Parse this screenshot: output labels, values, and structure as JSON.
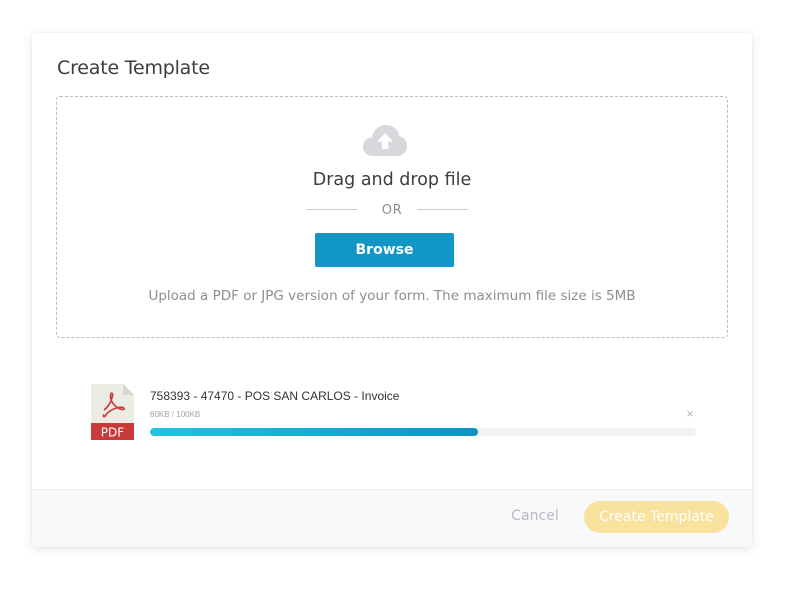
{
  "modal": {
    "title": "Create Template"
  },
  "dropzone": {
    "icon": "cloud-upload-icon",
    "drag_text": "Drag and drop file",
    "or_text": "OR",
    "browse_label": "Browse",
    "hint": "Upload a PDF or JPG version of your form. The maximum file size is 5MB"
  },
  "upload": {
    "file_icon": "pdf-file-icon",
    "file_icon_label": "PDF",
    "file_name": "758393 - 47470 - POS SAN CARLOS - Invoice",
    "file_size": "60KB / 100KB",
    "progress": 0.6,
    "remove_icon": "close-icon",
    "remove_glyph": "×"
  },
  "footer": {
    "cancel_label": "Cancel",
    "create_label": "Create Template"
  },
  "colors": {
    "accent": "#1196c6",
    "progress_start": "#23c3e3",
    "progress_end": "#0d93c3",
    "create_button": "#f9e29d",
    "pdf_red": "#c8393a"
  }
}
